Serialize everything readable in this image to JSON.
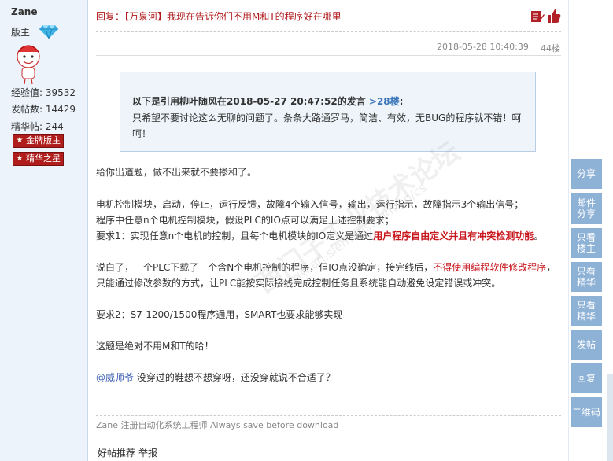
{
  "user": {
    "name": "Zane",
    "role": "版主",
    "stats": [
      {
        "label": "经验值:",
        "value": "39532"
      },
      {
        "label": "发帖数:",
        "value": "14429"
      },
      {
        "label": "精华帖:",
        "value": "244"
      }
    ],
    "badges": [
      "金牌版主",
      "精华之星"
    ]
  },
  "post": {
    "title": "回复：【万泉河】我现在告诉你们不用M和T的程序好在哪里",
    "datetime": "2018-05-28 10:40:39",
    "floor": "44楼",
    "quote": {
      "prefix": "以下是引用",
      "author": "柳叶随风",
      "middle": "在",
      "time": "2018-05-27 20:47:52",
      "suffix": "的发言",
      "floor_link": ">28楼",
      "colon": ":",
      "text": "只希望不要讨论这么无聊的问题了。条条大路通罗马，简洁、有效，无BUG的程序就不错！呵呵！"
    },
    "lines": {
      "l1": "给你出道题，做不出来就不要掺和了。",
      "l2": "电机控制模块，启动，停止，运行反馈，故障4个输入信号，输出，运行指示，故障指示3个输出信号；",
      "l3": "程序中任意n个电机控制模块，假设PLC的IO点可以满足上述控制要求；",
      "l4a": "要求1：实现任意n个电机的控制，且每个电机模块的IO定义是通过",
      "l4b": "用户程序自由定义并且有冲突检测功能",
      "l4c": "。",
      "l5a": "说白了，一个PLC下载了一个含N个电机控制的程序，但IO点没确定，接完线后，",
      "l5b": "不得使用编程软件修改程序",
      "l5c": "，",
      "l6": "只能通过修改参数的方式，让PLC能按实际接线完成控制任务且系统能自动避免设定错误或冲突。",
      "l7": "要求2：S7-1200/1500程序通用，SMART也要求能够实现",
      "l8": "这题是绝对不用M和T的哈！",
      "l9a": "@威师爷",
      "l9b": " 没穿过的鞋想不想穿呀，还没穿就说不合适了？"
    },
    "signature": "Zane 注册自动化系统工程师 Always save before download",
    "actions": [
      "好帖推荐",
      "举报"
    ]
  },
  "sidebar": [
    "分享",
    "邮件分享",
    "只看楼主",
    "只看精华",
    "只看精华",
    "发帖",
    "回复",
    "二维码"
  ],
  "watermark": "西门子工业技术论坛",
  "watermark_url": "www.ad.siemens.com.cn/cs"
}
